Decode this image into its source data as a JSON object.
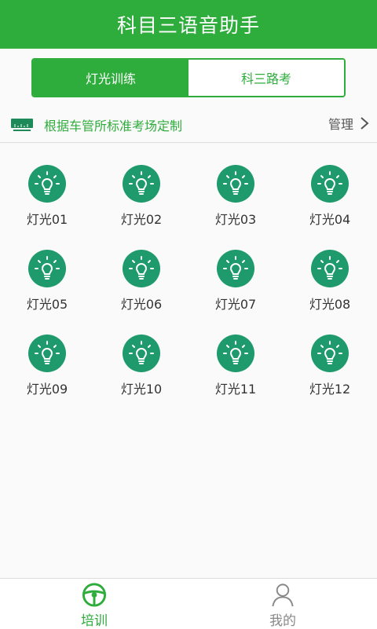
{
  "header": {
    "title": "科目三语音助手"
  },
  "tabs": [
    {
      "label": "灯光训练",
      "active": true
    },
    {
      "label": "科三路考",
      "active": false
    }
  ],
  "info": {
    "icon": "ruler-card-icon",
    "text": "根据车管所标准考场定制",
    "manage_label": "管理"
  },
  "lights": [
    {
      "label": "灯光01"
    },
    {
      "label": "灯光02"
    },
    {
      "label": "灯光03"
    },
    {
      "label": "灯光04"
    },
    {
      "label": "灯光05"
    },
    {
      "label": "灯光06"
    },
    {
      "label": "灯光07"
    },
    {
      "label": "灯光08"
    },
    {
      "label": "灯光09"
    },
    {
      "label": "灯光10"
    },
    {
      "label": "灯光11"
    },
    {
      "label": "灯光12"
    }
  ],
  "bottom_nav": [
    {
      "label": "培训",
      "icon": "steering-wheel-icon",
      "active": true
    },
    {
      "label": "我的",
      "icon": "user-icon",
      "active": false
    }
  ],
  "colors": {
    "brand_green": "#2eac3c",
    "bulb_green": "#1e9a6c",
    "inactive_gray": "#888888"
  }
}
